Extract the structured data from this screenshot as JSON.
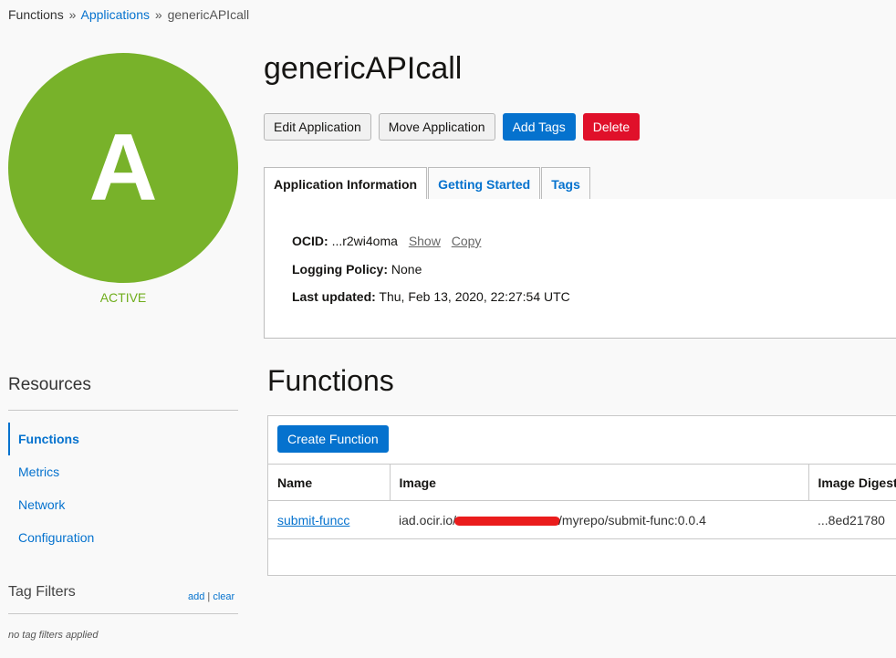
{
  "breadcrumb": {
    "root": "Functions",
    "sep1": "»",
    "applications": "Applications",
    "sep2": "»",
    "current": "genericAPIcall"
  },
  "app": {
    "avatar_letter": "A",
    "status": "ACTIVE",
    "status_color": "#78b22a",
    "title": "genericAPIcall"
  },
  "actions": {
    "edit": "Edit Application",
    "move": "Move Application",
    "add_tags": "Add Tags",
    "delete": "Delete"
  },
  "tabs": [
    "Application Information",
    "Getting Started",
    "Tags"
  ],
  "info": {
    "ocid_label": "OCID:",
    "ocid_value": "...r2wi4oma",
    "show": "Show",
    "copy": "Copy",
    "logging_label": "Logging Policy:",
    "logging_value": "None",
    "updated_label": "Last updated:",
    "updated_value": "Thu, Feb 13, 2020, 22:27:54 UTC"
  },
  "resources": {
    "title": "Resources",
    "items": [
      "Functions",
      "Metrics",
      "Network",
      "Configuration"
    ]
  },
  "tag_filters": {
    "title": "Tag Filters",
    "add": "add",
    "divider": "|",
    "clear": "clear",
    "empty": "no tag filters applied"
  },
  "functions": {
    "title": "Functions",
    "create_button": "Create Function",
    "columns": [
      "Name",
      "Image",
      "Image Digest"
    ],
    "rows": [
      {
        "name": "submit-funcc",
        "image_prefix": "iad.ocir.io/",
        "image_suffix": "/myrepo/submit-func:0.0.4",
        "digest": "...8ed21780"
      }
    ]
  },
  "colors": {
    "link": "#0572ce",
    "primary": "#0572ce",
    "danger": "#e0102a",
    "redaction": "#ea1c1c"
  }
}
